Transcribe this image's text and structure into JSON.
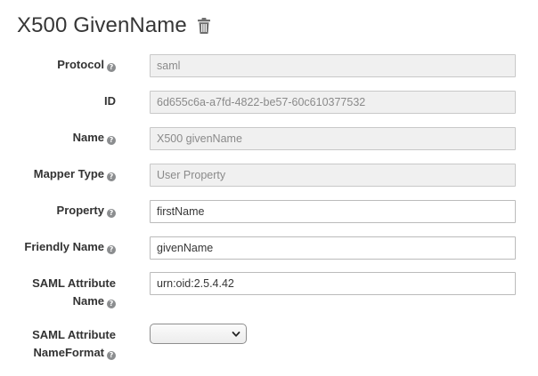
{
  "header": {
    "title": "X500 GivenName",
    "delete_icon": "trash-icon"
  },
  "form": {
    "protocol": {
      "label": "Protocol",
      "value": "saml"
    },
    "id": {
      "label": "ID",
      "value": "6d655c6a-a7fd-4822-be57-60c610377532"
    },
    "name": {
      "label": "Name",
      "value": "X500 givenName"
    },
    "mapper_type": {
      "label": "Mapper Type",
      "value": "User Property"
    },
    "property": {
      "label": "Property",
      "value": "firstName"
    },
    "friendly_name": {
      "label": "Friendly Name",
      "value": "givenName"
    },
    "saml_attribute_name": {
      "label_line1": "SAML Attribute",
      "label_line2": "Name",
      "value": "urn:oid:2.5.4.42"
    },
    "saml_attribute_nameformat": {
      "label_line1": "SAML Attribute",
      "label_line2": "NameFormat",
      "selected": ""
    }
  },
  "icons": {
    "help": "question-circle-icon",
    "help_glyph": "?"
  },
  "colors": {
    "readonly_bg": "#f0f0f0",
    "help_icon": "#8b8d8f"
  }
}
